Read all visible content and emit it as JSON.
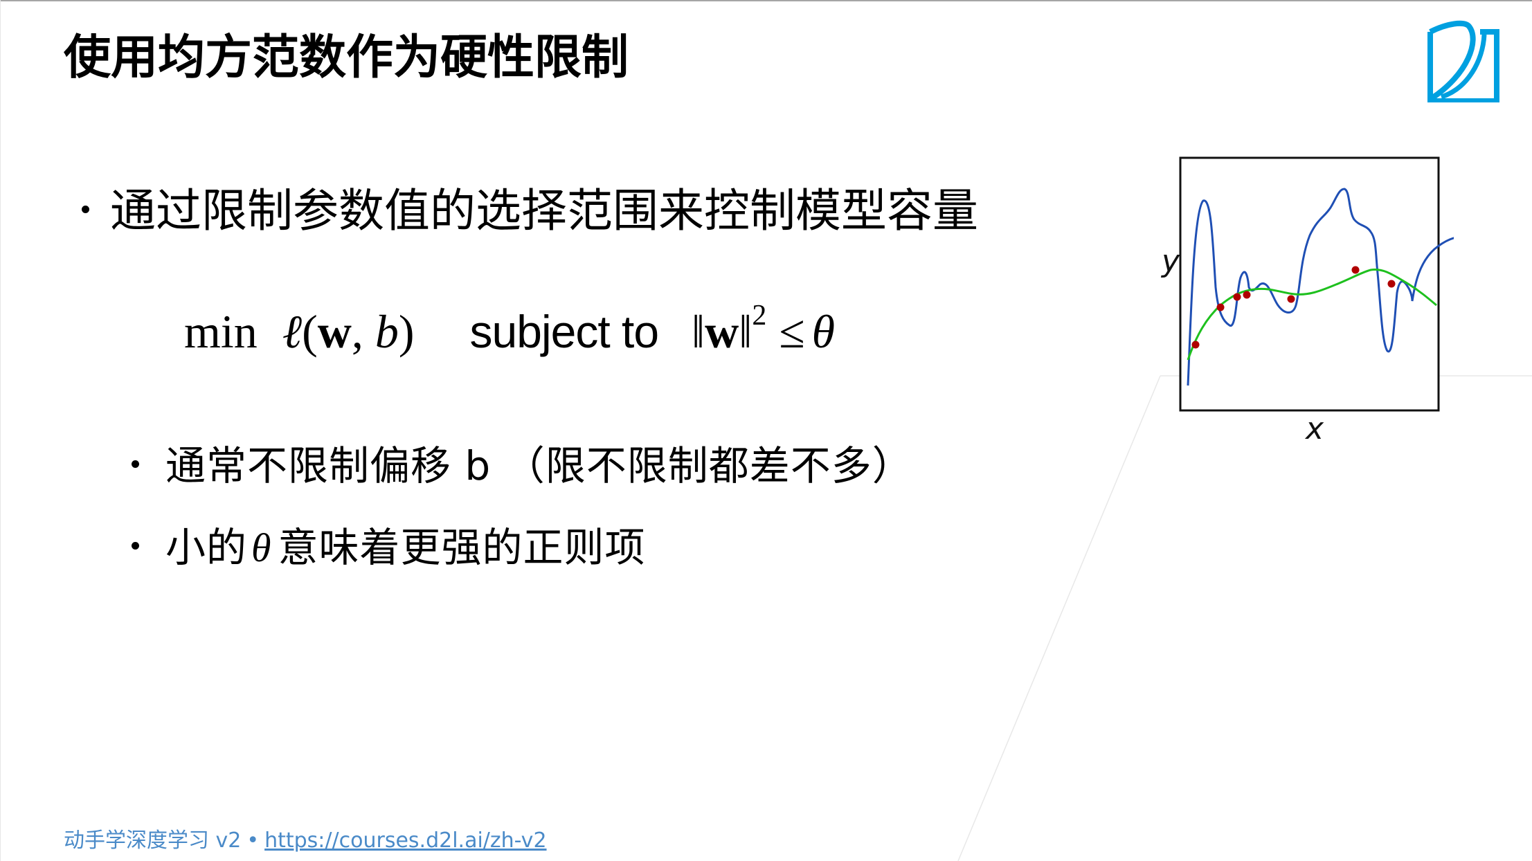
{
  "slide": {
    "title": "使用均方范数作为硬性限制",
    "bullets": [
      {
        "text": "通过限制参数值的选择范围来控制模型容量"
      }
    ],
    "formula": {
      "min": "min",
      "loss_symbol": "ℓ",
      "loss_open": "(",
      "w": "w",
      "comma": ", ",
      "b": "b",
      "loss_close": ")",
      "subject_to": "subject to",
      "norm_open": "‖",
      "norm_close": "‖",
      "exponent": "2",
      "leq": "≤",
      "theta": "θ"
    },
    "sub_bullets": [
      {
        "text": "通常不限制偏移 b （限不限制都差不多）"
      },
      {
        "before": "小的",
        "symbol": "θ",
        "after": "意味着更强的正则项"
      }
    ],
    "figure": {
      "x_label": "x",
      "y_label": "y",
      "colors": {
        "overfit_curve": "#1f4fb4",
        "smooth_curve": "#1ec01e",
        "points": "#b00000",
        "frame": "#111111"
      }
    },
    "footer": {
      "course": "动手学深度学习 v2",
      "separator": "•",
      "link": "https://courses.d2l.ai/zh-v2"
    },
    "brand_color": "#00a0e0"
  }
}
